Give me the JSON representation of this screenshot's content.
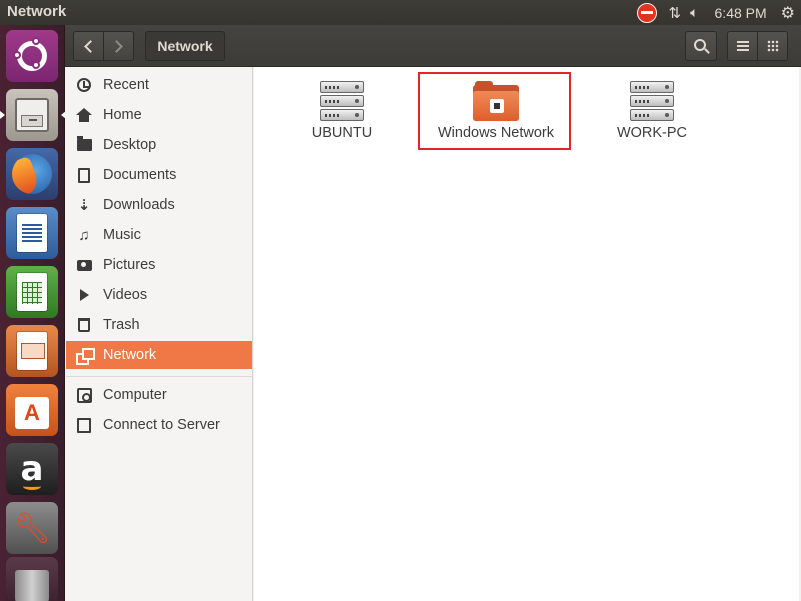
{
  "window": {
    "title": "Network"
  },
  "top_panel": {
    "time": "6:48 PM",
    "indicators": [
      "stop-icon",
      "network-updown-icon",
      "volume-icon",
      "gear-icon"
    ]
  },
  "launcher": {
    "items": [
      "ubuntu-dash",
      "files",
      "firefox",
      "libreoffice-writer",
      "libreoffice-calc",
      "libreoffice-impress",
      "ubuntu-software",
      "amazon",
      "system-settings",
      "trash"
    ]
  },
  "header": {
    "path_label": "Network"
  },
  "sidebar": {
    "places": [
      {
        "label": "Recent",
        "icon": "clock-icon"
      },
      {
        "label": "Home",
        "icon": "home-icon"
      },
      {
        "label": "Desktop",
        "icon": "folder-icon"
      },
      {
        "label": "Documents",
        "icon": "document-icon"
      },
      {
        "label": "Downloads",
        "icon": "download-icon"
      },
      {
        "label": "Music",
        "icon": "music-icon"
      },
      {
        "label": "Pictures",
        "icon": "camera-icon"
      },
      {
        "label": "Videos",
        "icon": "video-icon"
      },
      {
        "label": "Trash",
        "icon": "trash-icon"
      },
      {
        "label": "Network",
        "icon": "network-icon",
        "active": true
      }
    ],
    "devices": [
      {
        "label": "Computer",
        "icon": "computer-icon"
      },
      {
        "label": "Connect to Server",
        "icon": "connect-icon"
      }
    ]
  },
  "content": {
    "items": [
      {
        "label": "UBUNTU",
        "icon": "server-icon"
      },
      {
        "label": "Windows Network",
        "icon": "network-folder-icon",
        "highlighted": true
      },
      {
        "label": "WORK-PC",
        "icon": "server-icon"
      }
    ]
  },
  "colors": {
    "accent": "#f07746",
    "highlight_border": "#e5242b",
    "panel": "#3c3b37",
    "launcher": "#4a2233"
  }
}
